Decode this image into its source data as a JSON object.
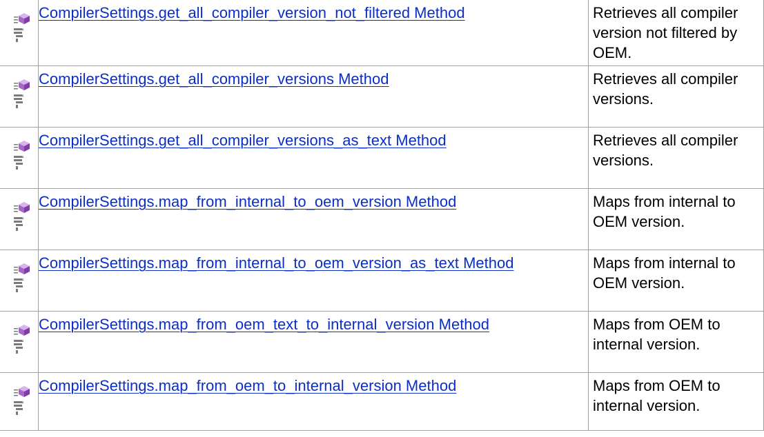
{
  "colors": {
    "link": "#0b2ec4",
    "border": "#a0a0a0",
    "method_icon_purple": "#a867c8",
    "method_icon_gray": "#7a7a7a"
  },
  "icons": {
    "method": "public-method-icon",
    "member": "member-icon"
  },
  "rows": [
    {
      "name": "CompilerSettings.get_all_compiler_version_not_filtered Method",
      "description": "Retrieves all compiler version not filtered by OEM."
    },
    {
      "name": "CompilerSettings.get_all_compiler_versions Method",
      "description": "Retrieves all compiler versions."
    },
    {
      "name": "CompilerSettings.get_all_compiler_versions_as_text Method",
      "description": "Retrieves all compiler versions."
    },
    {
      "name": "CompilerSettings.map_from_internal_to_oem_version Method",
      "description": "Maps from internal to OEM version."
    },
    {
      "name": "CompilerSettings.map_from_internal_to_oem_version_as_text Method",
      "description": "Maps from internal to OEM version."
    },
    {
      "name": "CompilerSettings.map_from_oem_text_to_internal_version Method",
      "description": "Maps from OEM to internal version."
    },
    {
      "name": "CompilerSettings.map_from_oem_to_internal_version Method",
      "description": "Maps from OEM to internal version."
    }
  ]
}
